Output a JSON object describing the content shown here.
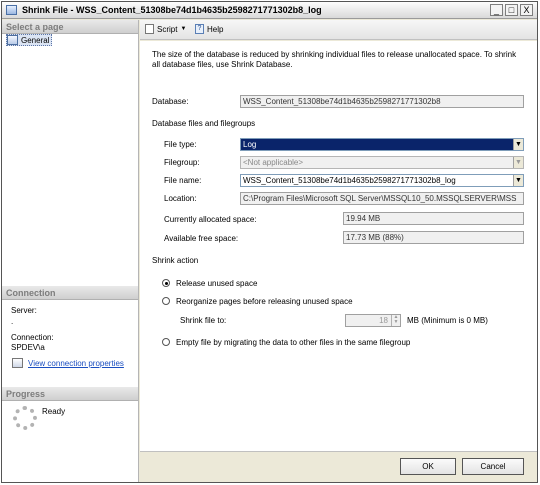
{
  "window": {
    "title": "Shrink File - WSS_Content_51308be74d1b4635b2598271771302b8_log",
    "controls": [
      "_",
      "□",
      "X"
    ]
  },
  "left_panel": {
    "select_page_header": "Select a page",
    "pages": [
      {
        "label": "General",
        "icon": "page-icon"
      }
    ],
    "connection_header": "Connection",
    "server_label": "Server:",
    "server_value": ".",
    "connection_label": "Connection:",
    "connection_value": "SPDEV\\a",
    "view_props_link": "View connection properties",
    "progress_header": "Progress",
    "progress_status": "Ready"
  },
  "toolbar": {
    "script_label": "Script",
    "help_label": "Help",
    "script_icon": "script-icon",
    "help_icon": "help-icon"
  },
  "main": {
    "description": "The size of the database is reduced by shrinking individual files to release unallocated space. To shrink all database files, use Shrink Database.",
    "database_label": "Database:",
    "database_value": "WSS_Content_51308be74d1b4635b2598271771302b8",
    "files_group_header": "Database files and filegroups",
    "file_type_label": "File type:",
    "file_type_value": "Log",
    "filegroup_label": "Filegroup:",
    "filegroup_value": "<Not applicable>",
    "file_name_label": "File name:",
    "file_name_value": "WSS_Content_51308be74d1b4635b2598271771302b8_log",
    "location_label": "Location:",
    "location_value": "C:\\Program Files\\Microsoft SQL Server\\MSSQL10_50.MSSQLSERVER\\MSS",
    "allocated_label": "Currently allocated space:",
    "allocated_value": "19.94 MB",
    "free_label": "Available free space:",
    "free_value": "17.73 MB (88%)",
    "shrink_action_header": "Shrink action",
    "opt_release": "Release unused space",
    "opt_reorganize": "Reorganize pages before releasing unused space",
    "shrink_file_to_label": "Shrink file to:",
    "shrink_value": "18",
    "shrink_unit": "MB (Minimum is 0 MB)",
    "opt_empty": "Empty file by migrating the data to other files in the same filegroup"
  },
  "footer": {
    "ok": "OK",
    "cancel": "Cancel"
  }
}
